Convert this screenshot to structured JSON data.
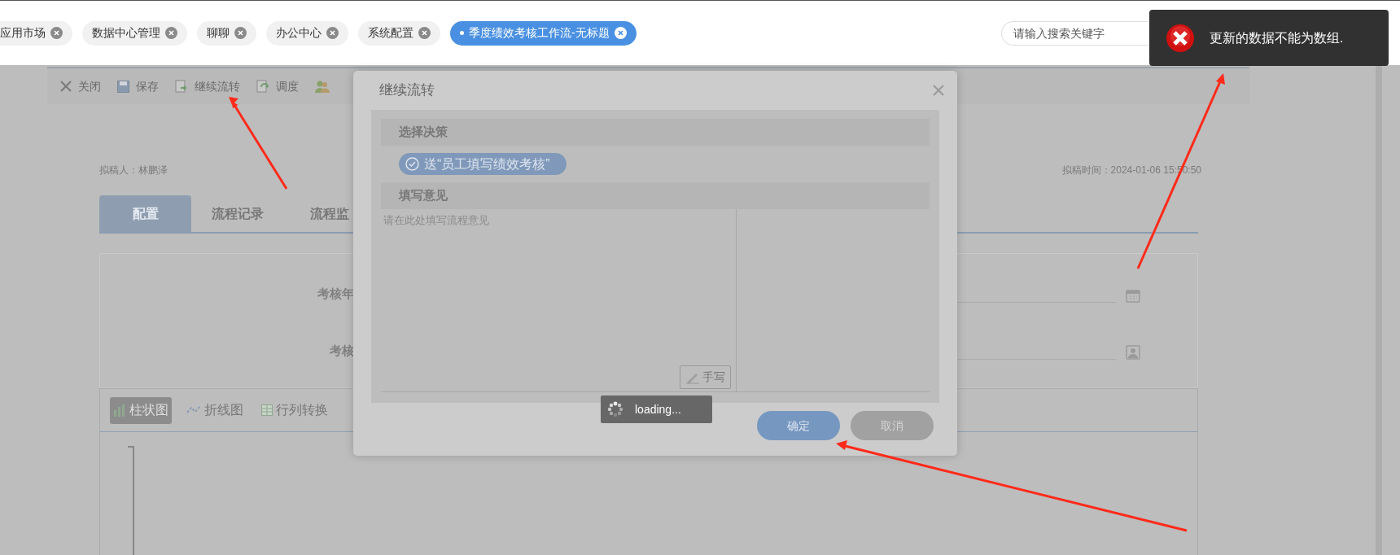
{
  "top_tabs": [
    {
      "label": "应用市场",
      "selected": false
    },
    {
      "label": "数据中心管理",
      "selected": false
    },
    {
      "label": "聊聊",
      "selected": false
    },
    {
      "label": "办公中心",
      "selected": false
    },
    {
      "label": "系统配置",
      "selected": false
    },
    {
      "label": "季度绩效考核工作流-无标题",
      "selected": true
    }
  ],
  "search": {
    "placeholder": "请输入搜索关键字"
  },
  "toast": {
    "kind": "error",
    "message": "更新的数据不能为数组."
  },
  "toolbar": [
    {
      "kind": "close",
      "label": "关闭"
    },
    {
      "kind": "save",
      "label": "保存"
    },
    {
      "kind": "forward",
      "label": "继续流转"
    },
    {
      "kind": "schedule",
      "label": "调度"
    },
    {
      "kind": "users"
    }
  ],
  "document": {
    "drafter": "拟稿人：林鹏泽",
    "draft_time": "拟稿时间：2024-01-06 15:50:50",
    "tabs": [
      {
        "label": "配置",
        "selected": true
      },
      {
        "label": "流程记录",
        "selected": false
      },
      {
        "label": "流程监",
        "selected": false
      }
    ],
    "fields": [
      {
        "label": "考核年",
        "kind": "date"
      },
      {
        "label": "考核",
        "kind": "person"
      }
    ],
    "chart_toolbar": [
      {
        "label": "柱状图",
        "kind": "bar",
        "selected": true
      },
      {
        "label": "折线图",
        "kind": "line",
        "selected": false
      },
      {
        "label": "行列转换",
        "kind": "swap",
        "selected": false
      }
    ]
  },
  "dialog": {
    "title": "继续流转",
    "decision_header": "选择决策",
    "decisions": [
      {
        "label": "送“员工填写绩效考核”",
        "selected": true
      }
    ],
    "opinion_header": "填写意见",
    "opinion": {
      "placeholder": "请在此处填写流程意见"
    },
    "handwrite_button": "手写",
    "buttons": [
      {
        "label": "确定",
        "kind": "primary"
      },
      {
        "label": "取消",
        "kind": "secondary"
      }
    ]
  },
  "loading": {
    "text": "loading..."
  }
}
